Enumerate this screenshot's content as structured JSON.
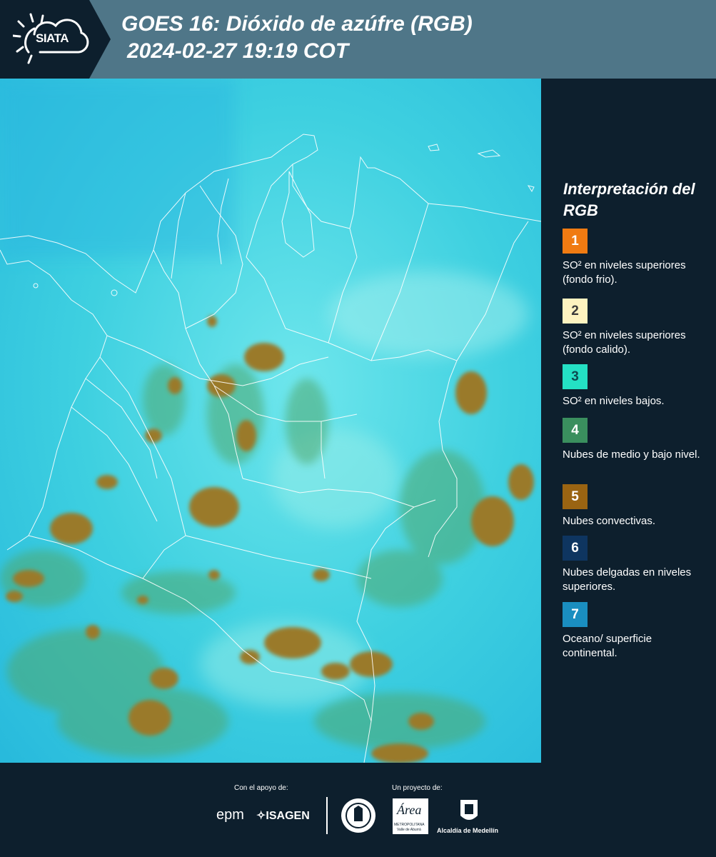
{
  "header": {
    "logo_text": "SIATA",
    "title_line1": "GOES 16: Dióxido de azúfre (RGB)",
    "title_line2": "2024-02-27 19:19 COT"
  },
  "legend": {
    "title": "Interpretación del RGB",
    "items": [
      {
        "number": "1",
        "color": "#f07b12",
        "number_color": "#ffffff",
        "text": "SO² en niveles superiores (fondo frio)."
      },
      {
        "number": "2",
        "color": "#fdf3c0",
        "number_color": "#3a3a3a",
        "text": "SO² en niveles superiores (fondo calido)."
      },
      {
        "number": "3",
        "color": "#24e0c4",
        "number_color": "#0d4a50",
        "text": "SO² en niveles bajos."
      },
      {
        "number": "4",
        "color": "#3a8f5e",
        "number_color": "#ffffff",
        "text": "Nubes de medio y bajo nivel."
      },
      {
        "number": "5",
        "color": "#9a6412",
        "number_color": "#ffffff",
        "text": "Nubes convectivas."
      },
      {
        "number": "6",
        "color": "#0e3560",
        "number_color": "#ffffff",
        "text": "Nubes delgadas en niveles superiores."
      },
      {
        "number": "7",
        "color": "#1a8ec0",
        "number_color": "#ffffff",
        "text": "Oceano/ superficie continental."
      }
    ]
  },
  "footer": {
    "support_label": "Con el apoyo de:",
    "project_label": "Un proyecto de:",
    "sponsor1": "epm",
    "sponsor2": "ISAGEN",
    "project1_line1": "METROPOLITANA",
    "project1_line2": "Valle de Aburrá",
    "project2": "Alcaldía de Medellín"
  }
}
